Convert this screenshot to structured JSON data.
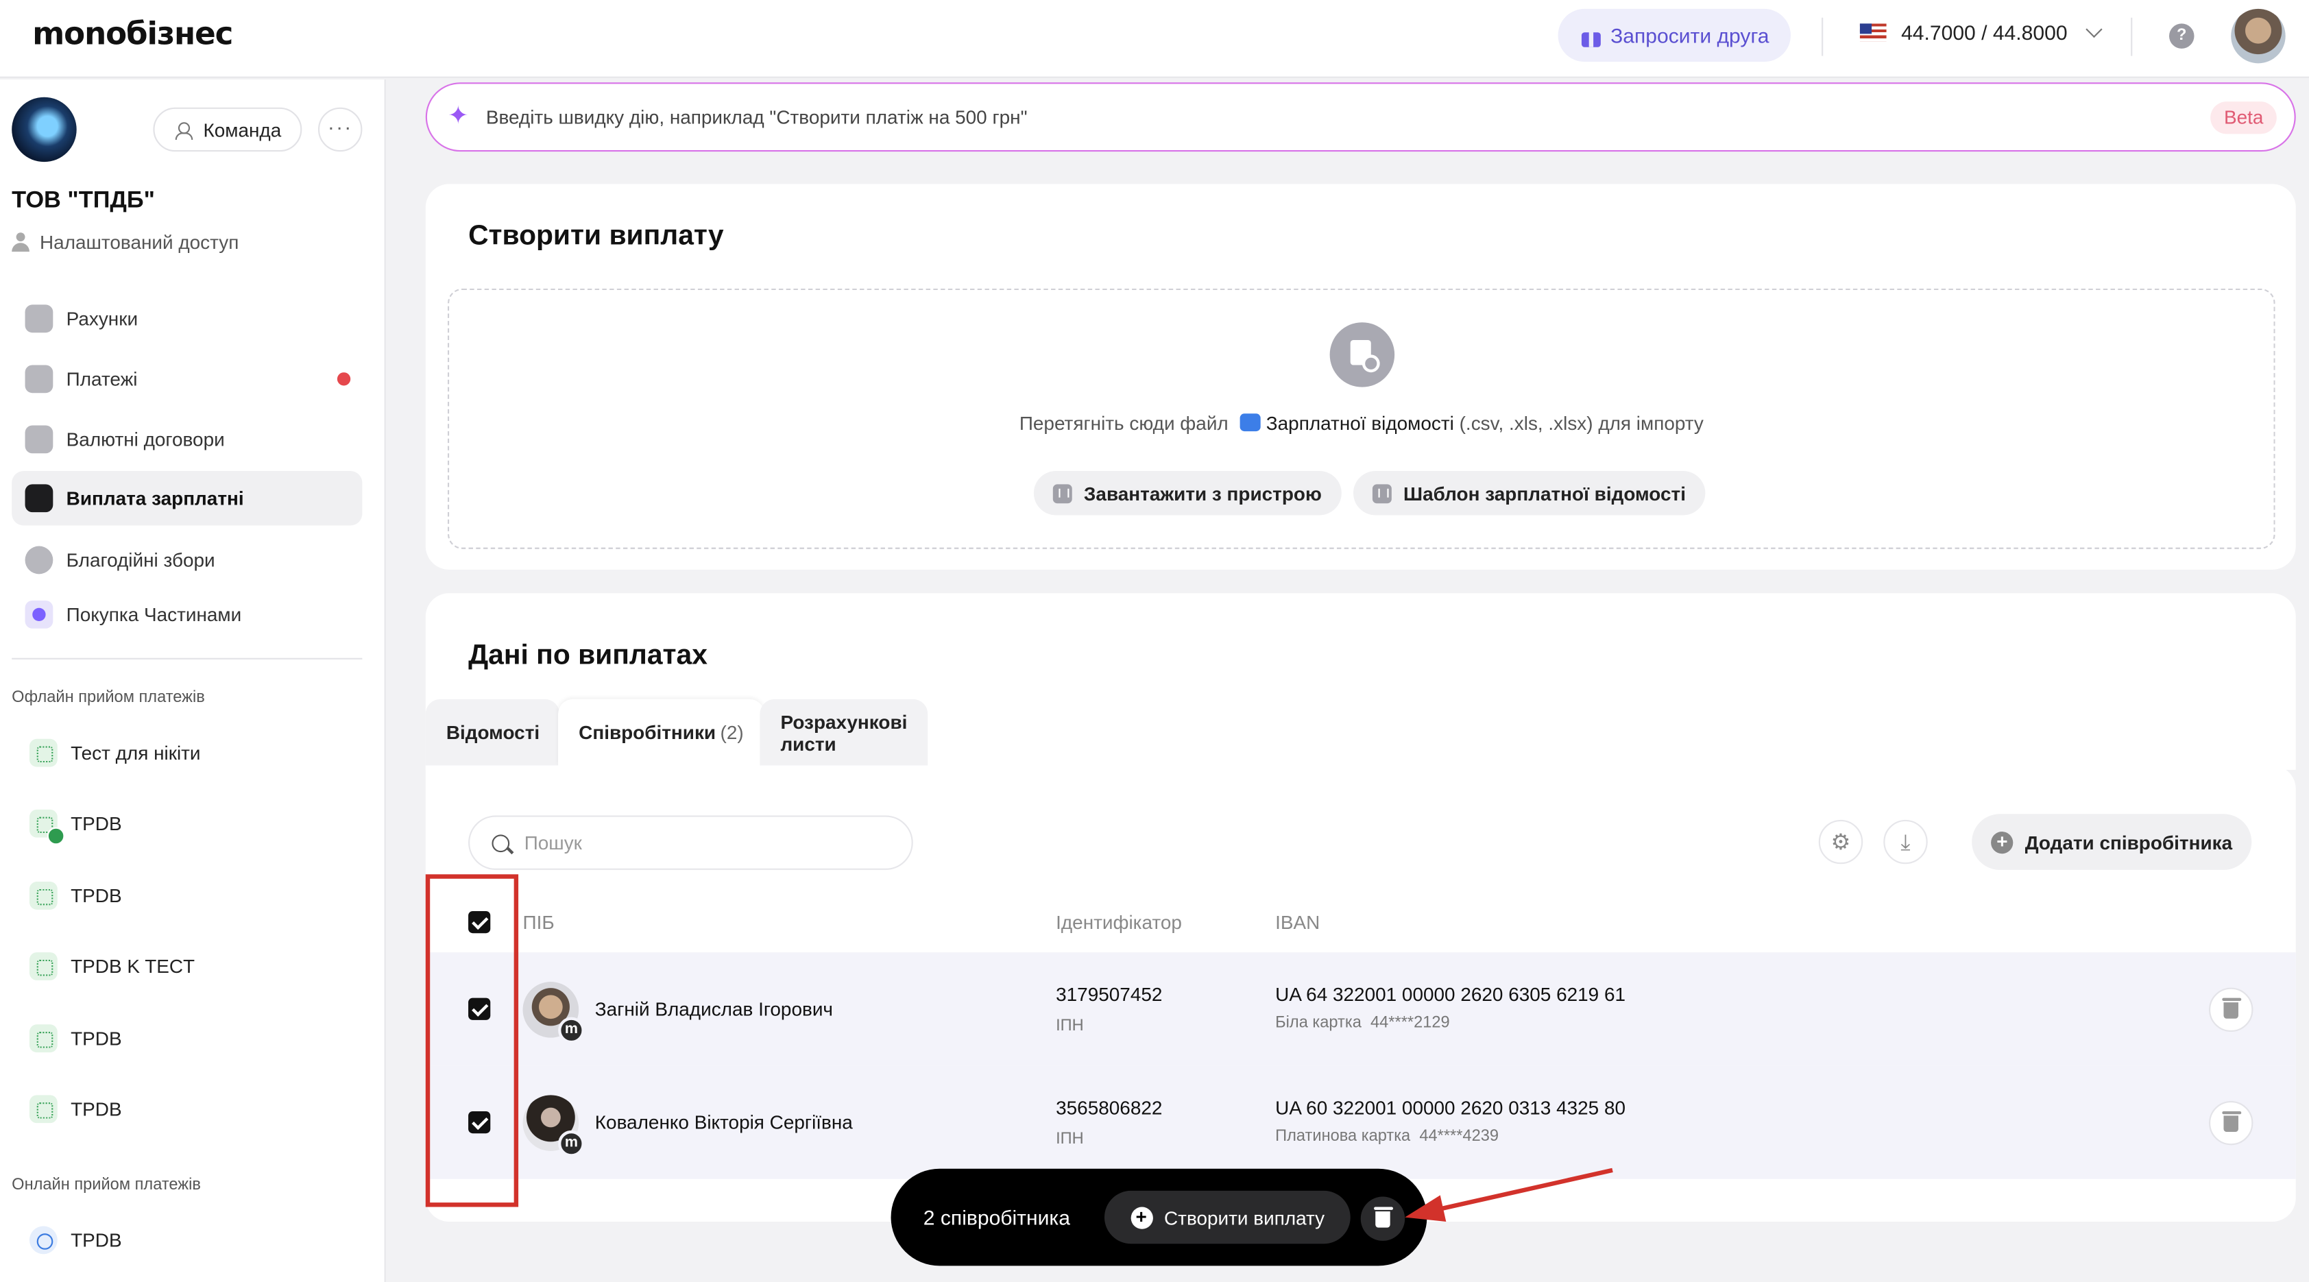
{
  "header": {
    "logo": "monoбізнес",
    "invite_label": "Запросити друга",
    "exchange_rate": "44.7000 / 44.8000",
    "help_symbol": "?"
  },
  "sidebar": {
    "team_label": "Команда",
    "more_label": "···",
    "org_name": "ТОВ \"ТПДБ\"",
    "access_label": "Налаштований доступ",
    "nav": [
      {
        "label": "Рахунки",
        "icon": "wallet-icon"
      },
      {
        "label": "Платежі",
        "icon": "transfer-icon",
        "badge": "red-dot"
      },
      {
        "label": "Валютні договори",
        "icon": "currency-contract-icon"
      },
      {
        "label": "Виплата зарплатні",
        "icon": "salary-icon",
        "active": true
      },
      {
        "label": "Благодійні збори",
        "icon": "charity-icon"
      },
      {
        "label": "Покупка Частинами",
        "icon": "paw-icon"
      }
    ],
    "offline_title": "Офлайн прийом платежів",
    "offline_items": [
      "Тест для нікіти",
      "TPDB",
      "TPDB",
      "TPDB K TECT",
      "TPDB",
      "TPDB"
    ],
    "online_title": "Онлайн прийом платежів",
    "online_items": [
      "TPDB"
    ]
  },
  "quick_action": {
    "placeholder": "Введіть швидку дію, наприклад \"Створити платіж на 500 грн\"",
    "badge": "Beta"
  },
  "create_payout": {
    "title": "Створити виплату",
    "drop_text_prefix": "Перетягніть сюди файл",
    "drop_file_name": "Зарплатної відомості",
    "drop_text_suffix": "(.csv, .xls, .xlsx) для імпорту",
    "upload_label": "Завантажити з пристрою",
    "template_label": "Шаблон зарплатної відомості"
  },
  "payout_data": {
    "title": "Дані по виплатах",
    "tabs": [
      {
        "label": "Відомості",
        "count": ""
      },
      {
        "label": "Співробітники",
        "count": "(2)",
        "active": true
      },
      {
        "label": "Розрахункові листи",
        "count": ""
      }
    ],
    "search_placeholder": "Пошук",
    "add_employee_label": "Додати співробітника",
    "columns": {
      "name": "ПІБ",
      "identifier": "Ідентифікатор",
      "iban": "IBAN"
    },
    "rows": [
      {
        "name": "Загній Владислав Ігорович",
        "identifier": "3179507452",
        "identifier_type": "ІПН",
        "iban": "UA 64 322001 00000 2620 6305 6219 61",
        "card_type": "Біла картка",
        "card_mask": "44****2129",
        "checked": true
      },
      {
        "name": "Коваленко Вікторія Сергіївна",
        "identifier": "3565806822",
        "identifier_type": "ІПН",
        "iban": "UA 60 322001 00000 2620 0313 4325 80",
        "card_type": "Платинова картка",
        "card_mask": "44****4239",
        "checked": true
      }
    ]
  },
  "selection_bar": {
    "count_label": "2 співробітника",
    "create_label": "Створити виплату"
  },
  "colors": {
    "accent": "#5a4fd1",
    "annotation_red": "#d2322b",
    "quick_border": "#d873e8"
  }
}
